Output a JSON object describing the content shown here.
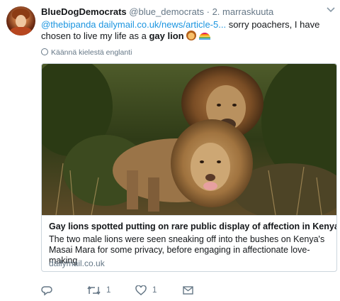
{
  "tweet": {
    "display_name": "BlueDogDemocrats",
    "handle": "@blue_democrats",
    "separator": "·",
    "date": "2. marraskuuta",
    "text": {
      "mention": "@thebipanda",
      "link": "dailymail.co.uk/news/article-5...",
      "middle": " sorry poachers, I have chosen to live my life as a ",
      "bold": "gay lion",
      "emojis": [
        "lion-face-emoji",
        "rainbow-emoji"
      ]
    },
    "translate_label": "Käännä kielestä englanti"
  },
  "card": {
    "title": "Gay lions spotted putting on rare public display of affection in Kenya",
    "description": "The two male lions were seen sneaking off into the bushes on Kenya's Masai Mara for some privacy, before engaging in affectionate love-making",
    "domain": "dailymail.co.uk",
    "image": "two-male-lions-photo"
  },
  "actions": {
    "reply": {
      "icon": "reply-icon",
      "count": ""
    },
    "retweet": {
      "icon": "retweet-icon",
      "count": "1"
    },
    "like": {
      "icon": "heart-icon",
      "count": "1"
    },
    "message": {
      "icon": "envelope-icon",
      "count": ""
    }
  },
  "colors": {
    "link": "#1b95e0",
    "secondary_text": "#657786",
    "border": "#ccd6dd"
  }
}
